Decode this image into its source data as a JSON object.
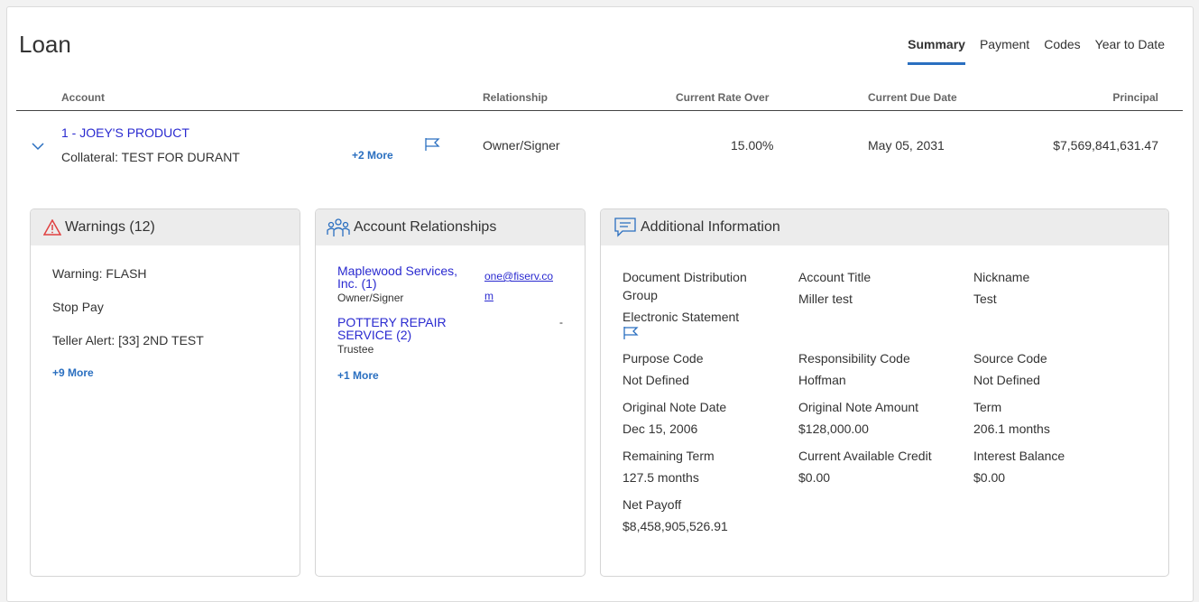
{
  "page": {
    "title": "Loan"
  },
  "tabs": [
    {
      "label": "Summary",
      "active": true
    },
    {
      "label": "Payment"
    },
    {
      "label": "Codes"
    },
    {
      "label": "Year to Date"
    }
  ],
  "table": {
    "headers": {
      "account": "Account",
      "relationship": "Relationship",
      "rate": "Current Rate Over",
      "due": "Current Due Date",
      "principal": "Principal"
    },
    "row": {
      "account": "1 - JOEY'S PRODUCT",
      "collateral": "Collateral: TEST FOR DURANT",
      "more": "+2 More",
      "relationship": "Owner/Signer",
      "rate": "15.00%",
      "due": "May 05, 2031",
      "principal": "$7,569,841,631.47"
    }
  },
  "warnings": {
    "title": "Warnings (12)",
    "items": [
      "Warning: FLASH",
      "Stop Pay",
      "Teller Alert: [33] 2ND TEST"
    ],
    "more": "+9 More"
  },
  "relationships": {
    "title": "Account Relationships",
    "items": [
      {
        "name": "Maplewood Services, Inc. (1)",
        "role": "Owner/Signer",
        "email": "one@fiserv.com"
      },
      {
        "name": "POTTERY REPAIR SERVICE (2)",
        "role": "Trustee",
        "email": "-"
      }
    ],
    "more": "+1 More"
  },
  "additional": {
    "title": "Additional Information",
    "fields": {
      "doc_dist": {
        "label": "Document Distribution Group",
        "value": ""
      },
      "account_title": {
        "label": "Account Title",
        "value": "Miller test"
      },
      "nickname": {
        "label": "Nickname",
        "value": "Test"
      },
      "estatement": {
        "label": "Electronic Statement"
      },
      "purpose": {
        "label": "Purpose Code",
        "value": "Not Defined"
      },
      "responsibility": {
        "label": "Responsibility Code",
        "value": "Hoffman"
      },
      "source": {
        "label": "Source Code",
        "value": "Not Defined"
      },
      "orig_date": {
        "label": "Original Note Date",
        "value": "Dec 15, 2006"
      },
      "orig_amount": {
        "label": "Original Note Amount",
        "value": "$128,000.00"
      },
      "term": {
        "label": "Term",
        "value": "206.1 months"
      },
      "remaining": {
        "label": "Remaining Term",
        "value": "127.5 months"
      },
      "avail_credit": {
        "label": "Current Available Credit",
        "value": "$0.00"
      },
      "interest": {
        "label": "Interest Balance",
        "value": "$0.00"
      },
      "payoff": {
        "label": "Net Payoff",
        "value": "$8,458,905,526.91"
      }
    }
  },
  "colors": {
    "accent": "#2a6fc0",
    "link": "#2a2ad0",
    "warning": "#e04040"
  },
  "icons": [
    "chevron-down-icon",
    "flag-icon",
    "warning-icon",
    "people-icon",
    "chat-icon"
  ]
}
